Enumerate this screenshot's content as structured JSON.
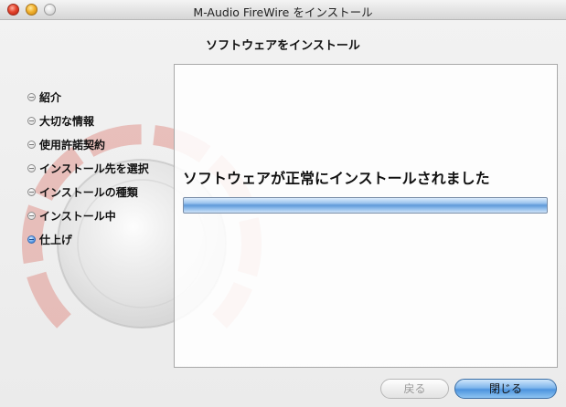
{
  "window": {
    "title": "M-Audio FireWire をインストール"
  },
  "header": {
    "subtitle": "ソフトウェアをインストール"
  },
  "steps": [
    {
      "label": "紹介",
      "active": false
    },
    {
      "label": "大切な情報",
      "active": false
    },
    {
      "label": "使用許諾契約",
      "active": false
    },
    {
      "label": "インストール先を選択",
      "active": false
    },
    {
      "label": "インストールの種類",
      "active": false
    },
    {
      "label": "インストール中",
      "active": false
    },
    {
      "label": "仕上げ",
      "active": true
    }
  ],
  "main": {
    "message": "ソフトウェアが正常にインストールされました",
    "progress": 1.0
  },
  "buttons": {
    "back_label": "戻る",
    "close_label": "閉じる"
  },
  "colors": {
    "accent_blue": "#4d94de",
    "dial_red": "#d9635a"
  }
}
